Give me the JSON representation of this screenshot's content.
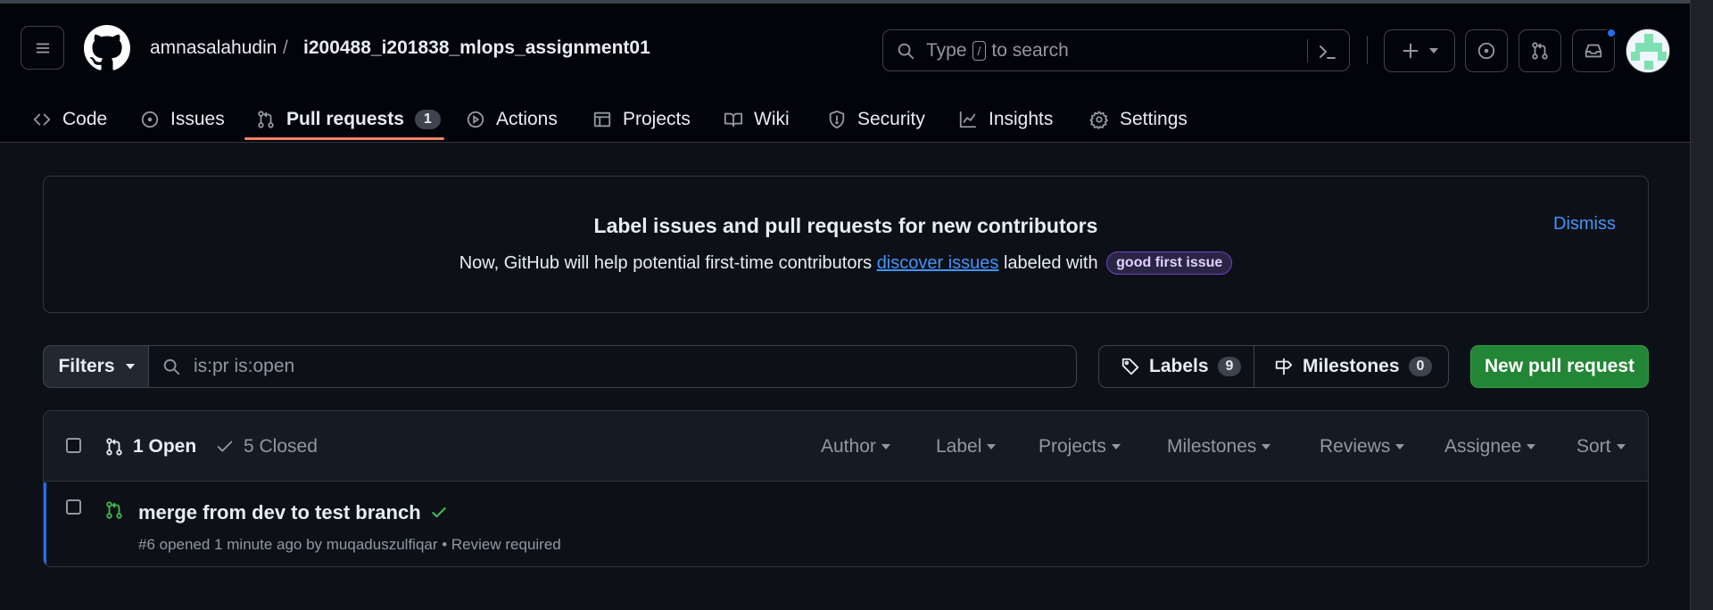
{
  "header": {
    "owner": "amnasalahudin",
    "separator": "/",
    "repo": "i200488_i201838_mlops_assignment01",
    "search_prefix": "Type",
    "search_key": "/",
    "search_suffix": "to search"
  },
  "tabs": [
    {
      "label": "Code",
      "icon": "code-icon"
    },
    {
      "label": "Issues",
      "icon": "issue-icon"
    },
    {
      "label": "Pull requests",
      "icon": "pull-request-icon",
      "count": "1",
      "active": true
    },
    {
      "label": "Actions",
      "icon": "play-icon"
    },
    {
      "label": "Projects",
      "icon": "table-icon"
    },
    {
      "label": "Wiki",
      "icon": "book-icon"
    },
    {
      "label": "Security",
      "icon": "shield-icon"
    },
    {
      "label": "Insights",
      "icon": "graph-icon"
    },
    {
      "label": "Settings",
      "icon": "gear-icon"
    }
  ],
  "banner": {
    "title": "Label issues and pull requests for new contributors",
    "text_before": "Now, GitHub will help potential first-time contributors",
    "link": "discover issues",
    "text_after": "labeled with",
    "label": "good first issue",
    "dismiss": "Dismiss"
  },
  "toolbar": {
    "filters": "Filters",
    "query": "is:pr is:open",
    "labels": "Labels",
    "labels_count": "9",
    "milestones": "Milestones",
    "milestones_count": "0",
    "new_pr": "New pull request"
  },
  "list_header": {
    "open": "1 Open",
    "closed": "5 Closed",
    "filters": [
      "Author",
      "Label",
      "Projects",
      "Milestones",
      "Reviews",
      "Assignee",
      "Sort"
    ]
  },
  "pull_requests": [
    {
      "title": "merge from dev to test branch",
      "meta": "#6 opened 1 minute ago by muqaduszulfiqar • Review required"
    }
  ],
  "colors": {
    "background": "#0d1117",
    "header": "#010409",
    "accent_link": "#4493f8",
    "primary_button": "#238636",
    "active_tab_underline": "#f78166",
    "open_pr_green": "#3fb950"
  }
}
